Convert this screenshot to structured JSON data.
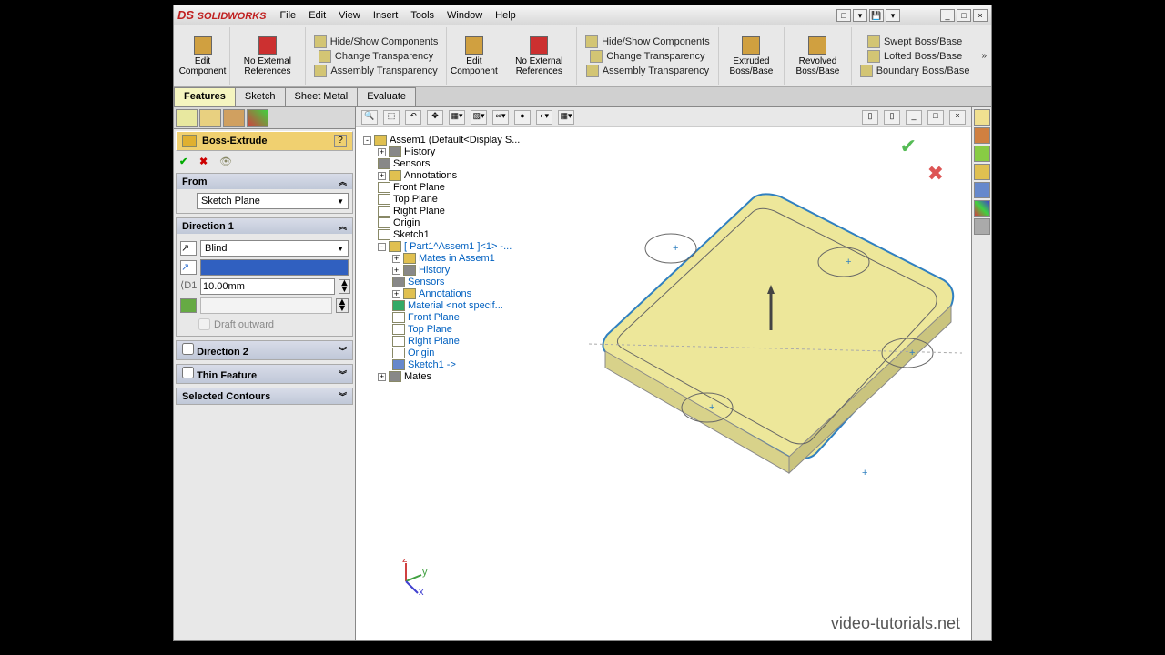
{
  "app_title": "SOLIDWORKS",
  "menu": [
    "File",
    "Edit",
    "View",
    "Insert",
    "Tools",
    "Window",
    "Help"
  ],
  "ribbon": {
    "g1": {
      "big": "Edit Component"
    },
    "g2": {
      "big": "No External References"
    },
    "g3": [
      "Hide/Show Components",
      "Change Transparency",
      "Assembly Transparency"
    ],
    "g4": {
      "big": "Edit Component"
    },
    "g5": {
      "big": "No External References"
    },
    "g6": [
      "Hide/Show Components",
      "Change Transparency",
      "Assembly Transparency"
    ],
    "g7": {
      "big": "Extruded Boss/Base"
    },
    "g8": {
      "big": "Revolved Boss/Base"
    },
    "g9": [
      "Swept Boss/Base",
      "Lofted Boss/Base",
      "Boundary Boss/Base"
    ]
  },
  "tabs": [
    "Features",
    "Sketch",
    "Sheet Metal",
    "Evaluate"
  ],
  "active_tab": 0,
  "pm": {
    "title": "Boss-Extrude",
    "from": {
      "head": "From",
      "value": "Sketch Plane"
    },
    "dir1": {
      "head": "Direction 1",
      "type": "Blind",
      "depth": "10.00mm",
      "draft_outward": "Draft outward"
    },
    "dir2": {
      "head": "Direction 2"
    },
    "thin": {
      "head": "Thin Feature"
    },
    "contours": {
      "head": "Selected Contours"
    }
  },
  "tree": {
    "root": "Assem1 (Default<Display S...",
    "n1": "History",
    "n2": "Sensors",
    "n3": "Annotations",
    "n4": "Front Plane",
    "n5": "Top Plane",
    "n6": "Right Plane",
    "n7": "Origin",
    "n8": "Sketch1",
    "part": "[ Part1^Assem1 ]<1> -...",
    "p1": "Mates in Assem1",
    "p2": "History",
    "p3": "Sensors",
    "p4": "Annotations",
    "p5": "Material <not specif...",
    "p6": "Front Plane",
    "p7": "Top Plane",
    "p8": "Right Plane",
    "p9": "Origin",
    "p10": "Sketch1 ->",
    "mates": "Mates"
  },
  "watermark": "video-tutorials.net"
}
